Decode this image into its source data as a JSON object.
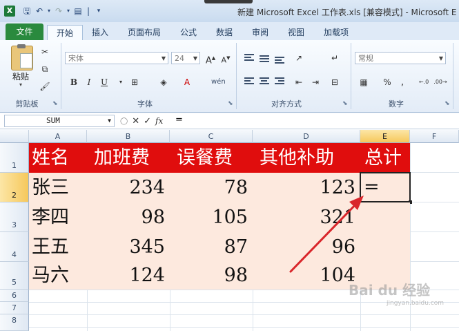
{
  "window": {
    "title": "新建 Microsoft Excel 工作表.xls  [兼容模式] - Microsoft E",
    "app_icon": "X",
    "quick_access": [
      "save-icon",
      "undo-icon",
      "redo-icon",
      "print-preview-icon",
      "customize-icon"
    ]
  },
  "ribbon_tabs": [
    "文件",
    "开始",
    "插入",
    "页面布局",
    "公式",
    "数据",
    "审阅",
    "视图",
    "加载项"
  ],
  "ribbon": {
    "clipboard": {
      "paste_label": "粘贴",
      "group_label": "剪贴板"
    },
    "font": {
      "font_name": "宋体",
      "font_size": "24",
      "bold": "B",
      "italic": "I",
      "underline": "U",
      "group_label": "字体",
      "font_color_glyph": "A",
      "phonetic_glyph": "wén"
    },
    "alignment": {
      "group_label": "对齐方式"
    },
    "number": {
      "format": "常规",
      "percent": "%",
      "group_label": "数字"
    }
  },
  "formula_bar": {
    "name_box": "SUM",
    "formula": "=",
    "fx_label": "fx"
  },
  "columns": [
    "A",
    "B",
    "C",
    "D",
    "E",
    "F"
  ],
  "rows": [
    "1",
    "2",
    "3",
    "4",
    "5",
    "6",
    "7",
    "8"
  ],
  "table": {
    "headers": [
      "姓名",
      "加班费",
      "误餐费",
      "其他补助",
      "总计"
    ],
    "data": [
      [
        "张三",
        "234",
        "78",
        "123",
        "="
      ],
      [
        "李四",
        "98",
        "105",
        "321",
        ""
      ],
      [
        "王五",
        "345",
        "87",
        "96",
        ""
      ],
      [
        "马六",
        "124",
        "98",
        "104",
        ""
      ]
    ]
  },
  "colors": {
    "header_fill": "#e00d0d",
    "data_fill": "#fde9de",
    "arrow": "#d9262b"
  },
  "watermark": {
    "text": "Bai du 经验",
    "sub": "jingyan.baidu.com"
  }
}
